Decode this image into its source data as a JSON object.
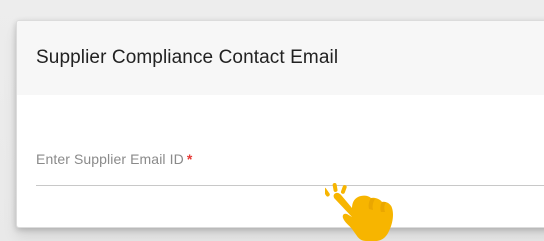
{
  "card": {
    "title": "Supplier Compliance Contact Email"
  },
  "email_field": {
    "label": "Enter Supplier Email ID",
    "required_marker": "*",
    "value": ""
  },
  "cursor": {
    "icon": "hand-pointer-icon",
    "color": "#f7b500"
  },
  "colors": {
    "required": "#e53935",
    "header_bg": "#f7f7f7",
    "placeholder": "#8a8a8a"
  }
}
